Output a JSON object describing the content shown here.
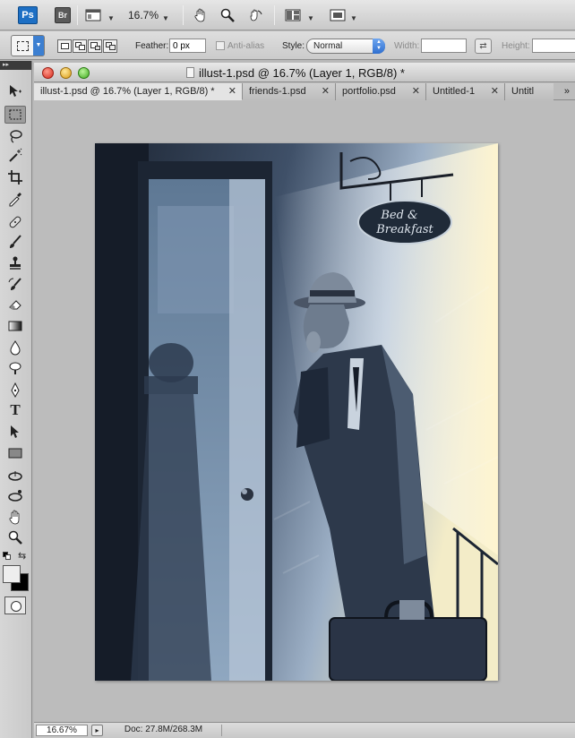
{
  "appbar": {
    "ps_label": "Ps",
    "br_label": "Br",
    "zoom_level": "16.7%"
  },
  "options": {
    "feather_label": "Feather:",
    "feather_value": "0 px",
    "antialias_label": "Anti-alias",
    "style_label": "Style:",
    "style_value": "Normal",
    "width_label": "Width:",
    "width_value": "",
    "height_label": "Height:",
    "height_value": ""
  },
  "toolbox": {
    "header": "▸▸"
  },
  "document": {
    "title": "illust-1.psd @ 16.7% (Layer 1, RGB/8) *",
    "tabs": [
      {
        "label": "illust-1.psd @ 16.7% (Layer 1, RGB/8) *",
        "active": true
      },
      {
        "label": "friends-1.psd",
        "active": false
      },
      {
        "label": "portfolio.psd",
        "active": false
      },
      {
        "label": "Untitled-1",
        "active": false
      },
      {
        "label": "Untitl",
        "active": false
      }
    ],
    "tab_overflow": "»",
    "artwork_sign_line1": "Bed &",
    "artwork_sign_line2": "Breakfast"
  },
  "status": {
    "zoom": "16.67%",
    "doc_info": "Doc: 27.8M/268.3M"
  }
}
